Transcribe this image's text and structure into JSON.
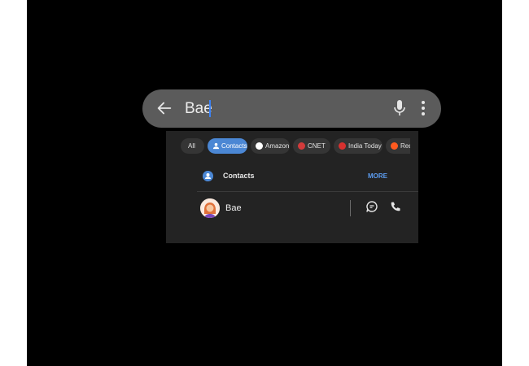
{
  "search": {
    "query": "Bae",
    "icons": {
      "back": "arrow-left-icon",
      "mic": "microphone-icon",
      "more": "more-vert-icon"
    }
  },
  "filters": {
    "chips": [
      {
        "label": "All",
        "icon": "",
        "active": false
      },
      {
        "label": "Contacts",
        "icon": "person-icon",
        "active": true
      },
      {
        "label": "Amazon",
        "icon": "amazon-logo-icon",
        "active": false
      },
      {
        "label": "CNET",
        "icon": "cnet-logo-icon",
        "active": false
      },
      {
        "label": "India Today",
        "icon": "india-today-logo-icon",
        "active": false
      },
      {
        "label": "Reddit",
        "icon": "reddit-logo-icon",
        "active": false
      }
    ]
  },
  "results": {
    "section_title": "Contacts",
    "more_label": "MORE",
    "contacts": [
      {
        "name": "Bae",
        "avatar": "woman-emoji-avatar",
        "actions": [
          "message-icon",
          "call-icon"
        ]
      }
    ]
  },
  "colors": {
    "accent": "#4b87d4",
    "link": "#5c9cf0",
    "search_bar": "#5b5b5b",
    "panel": "#232323",
    "background": "#000000"
  }
}
